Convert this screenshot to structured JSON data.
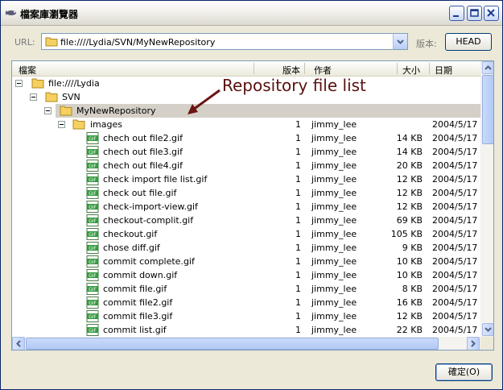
{
  "window": {
    "title": "檔案庫瀏覽器"
  },
  "toolbar": {
    "url_label": "URL:",
    "url_value": "file:////Lydia/SVN/MyNewRepository",
    "revision_label": "版本:",
    "head_button": "HEAD"
  },
  "columns": {
    "file": "檔案",
    "revision": "版本",
    "author": "作者",
    "size": "大小",
    "date": "日期"
  },
  "tree": [
    {
      "name": "file:////Lydia",
      "type": "folder",
      "level": 0,
      "expanded": true
    },
    {
      "name": "SVN",
      "type": "folder",
      "level": 1,
      "expanded": true
    },
    {
      "name": "MyNewRepository",
      "type": "folder",
      "level": 2,
      "expanded": true,
      "selected": true
    },
    {
      "name": "images",
      "type": "folder",
      "level": 3,
      "expanded": true,
      "revision": "1",
      "author": "jimmy_lee",
      "date": "2004/5/17"
    }
  ],
  "files": [
    {
      "name": "chech out file2.gif",
      "revision": "1",
      "author": "jimmy_lee",
      "size": "14 KB",
      "date": "2004/5/17"
    },
    {
      "name": "chech out file3.gif",
      "revision": "1",
      "author": "jimmy_lee",
      "size": "14 KB",
      "date": "2004/5/17"
    },
    {
      "name": "chech out file4.gif",
      "revision": "1",
      "author": "jimmy_lee",
      "size": "20 KB",
      "date": "2004/5/17"
    },
    {
      "name": "check import file list.gif",
      "revision": "1",
      "author": "jimmy_lee",
      "size": "12 KB",
      "date": "2004/5/17"
    },
    {
      "name": "check out file.gif",
      "revision": "1",
      "author": "jimmy_lee",
      "size": "12 KB",
      "date": "2004/5/17"
    },
    {
      "name": "check-import-view.gif",
      "revision": "1",
      "author": "jimmy_lee",
      "size": "12 KB",
      "date": "2004/5/17"
    },
    {
      "name": "checkout-complit.gif",
      "revision": "1",
      "author": "jimmy_lee",
      "size": "69 KB",
      "date": "2004/5/17"
    },
    {
      "name": "checkout.gif",
      "revision": "1",
      "author": "jimmy_lee",
      "size": "105 KB",
      "date": "2004/5/17"
    },
    {
      "name": "chose diff.gif",
      "revision": "1",
      "author": "jimmy_lee",
      "size": "9 KB",
      "date": "2004/5/17"
    },
    {
      "name": "commit complete.gif",
      "revision": "1",
      "author": "jimmy_lee",
      "size": "10 KB",
      "date": "2004/5/17"
    },
    {
      "name": "commit down.gif",
      "revision": "1",
      "author": "jimmy_lee",
      "size": "10 KB",
      "date": "2004/5/17"
    },
    {
      "name": "commit file.gif",
      "revision": "1",
      "author": "jimmy_lee",
      "size": "8 KB",
      "date": "2004/5/17"
    },
    {
      "name": "commit file2.gif",
      "revision": "1",
      "author": "jimmy_lee",
      "size": "16 KB",
      "date": "2004/5/17"
    },
    {
      "name": "commit file3.gif",
      "revision": "1",
      "author": "jimmy_lee",
      "size": "12 KB",
      "date": "2004/5/17"
    },
    {
      "name": "commit list.gif",
      "revision": "1",
      "author": "jimmy_lee",
      "size": "22 KB",
      "date": "2004/5/17"
    }
  ],
  "file_icon_label": "GIF",
  "annotation": "Repository file list",
  "ok_button": "確定(O)",
  "colors": {
    "folder": "#f5d060",
    "gif_icon": "#2f9a3a",
    "annotation": "#5a1010",
    "selection": "#d4d0c8"
  }
}
